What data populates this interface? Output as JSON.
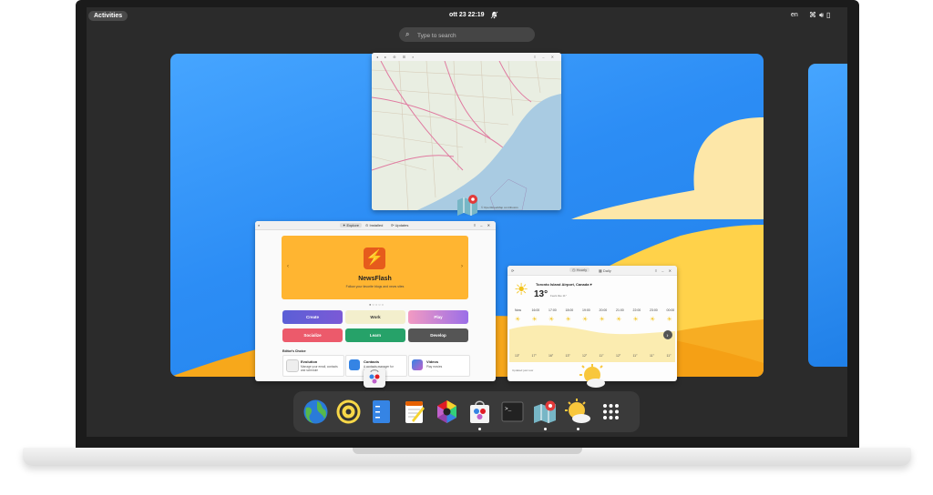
{
  "topbar": {
    "activities": "Activities",
    "clock": "ott 23  22:19",
    "bell_icon": "bell-off-icon",
    "language": "en",
    "tray_icons": [
      "network-icon",
      "volume-icon",
      "battery-icon"
    ]
  },
  "search": {
    "placeholder": "Type to search"
  },
  "software": {
    "tabs": [
      "Explore",
      "Installed",
      "Updates"
    ],
    "banner_title": "NewsFlash",
    "banner_subtitle": "Follow your favorite blogs and news sites",
    "categories": [
      "Create",
      "Work",
      "Play",
      "Socialize",
      "Learn",
      "Develop"
    ],
    "editors_choice": "Editor's Choice",
    "cards": [
      {
        "title": "Evolution",
        "desc": "Manage your email, contacts and schedule"
      },
      {
        "title": "Contacts",
        "desc": "A contacts manager for GNOME"
      },
      {
        "title": "Videos",
        "desc": "Play movies"
      }
    ]
  },
  "weather": {
    "tabs": [
      "Hourly",
      "Daily"
    ],
    "location": "Toronto Island Airport, Canada",
    "temperature": "13°",
    "feels_like": "Feels like 11°",
    "hours": [
      "Now",
      "16:00",
      "17:00",
      "18:00",
      "19:00",
      "20:00",
      "21:00",
      "22:00",
      "23:00",
      "00:00"
    ],
    "temps": [
      "13°",
      "17°",
      "16°",
      "13°",
      "12°",
      "11°",
      "12°",
      "11°",
      "11°",
      "11°"
    ],
    "footer": "Updated just now"
  },
  "map": {
    "attribution": "© OpenStreetMap contributors"
  },
  "dock": {
    "apps": [
      {
        "name": "web-browser-icon",
        "running": false
      },
      {
        "name": "rhythmbox-icon",
        "running": false
      },
      {
        "name": "files-icon",
        "running": false
      },
      {
        "name": "text-editor-icon",
        "running": false
      },
      {
        "name": "color-picker-icon",
        "running": false
      },
      {
        "name": "software-icon",
        "running": true
      },
      {
        "name": "terminal-icon",
        "running": false
      },
      {
        "name": "maps-icon",
        "running": true
      },
      {
        "name": "weather-icon",
        "running": true
      },
      {
        "name": "app-grid-icon",
        "running": false
      }
    ]
  },
  "colors": {
    "accent": "#3584e4",
    "banner": "#ffb531",
    "wallpaper": "#2c8df5",
    "dock": "#3a3a3a"
  }
}
